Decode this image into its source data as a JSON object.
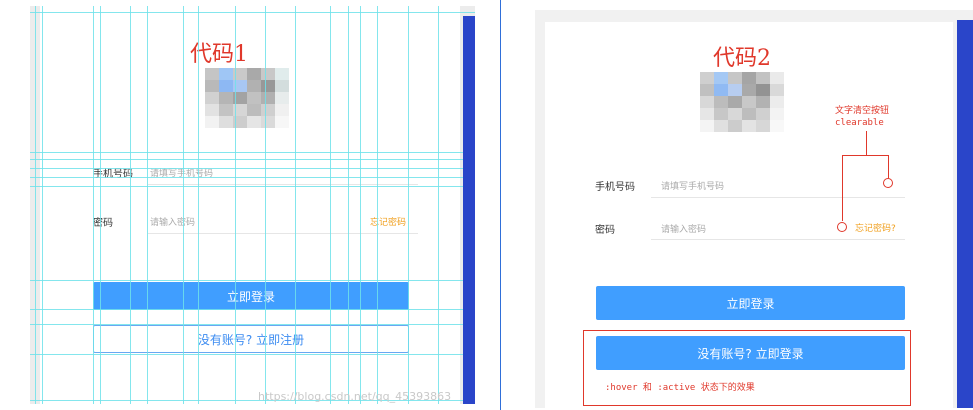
{
  "code1": {
    "title": "代码1",
    "phone_label": "手机号码",
    "phone_placeholder": "请填写手机号码",
    "password_label": "密码",
    "password_placeholder": "请输入密码",
    "forgot_link": "忘记密码",
    "login_button": "立即登录",
    "register_button": "没有账号? 立即注册"
  },
  "code2": {
    "title": "代码2",
    "phone_label": "手机号码",
    "phone_placeholder": "请填写手机号码",
    "password_label": "密码",
    "password_placeholder": "请输入密码",
    "forgot_link": "忘记密码?",
    "login_button": "立即登录",
    "register_button": "没有账号? 立即登录",
    "annotation_title": "文字清空按钮",
    "annotation_sub": "clearable",
    "state_note": ":hover 和 :active 状态下的效果"
  },
  "watermark": "https://blog.csdn.net/qq_45393863",
  "colors": {
    "primary": "#409eff",
    "annotation": "#e0382b",
    "link": "#f0a020",
    "guides": "#6fe2ea",
    "side_bar": "#2a45c9"
  }
}
